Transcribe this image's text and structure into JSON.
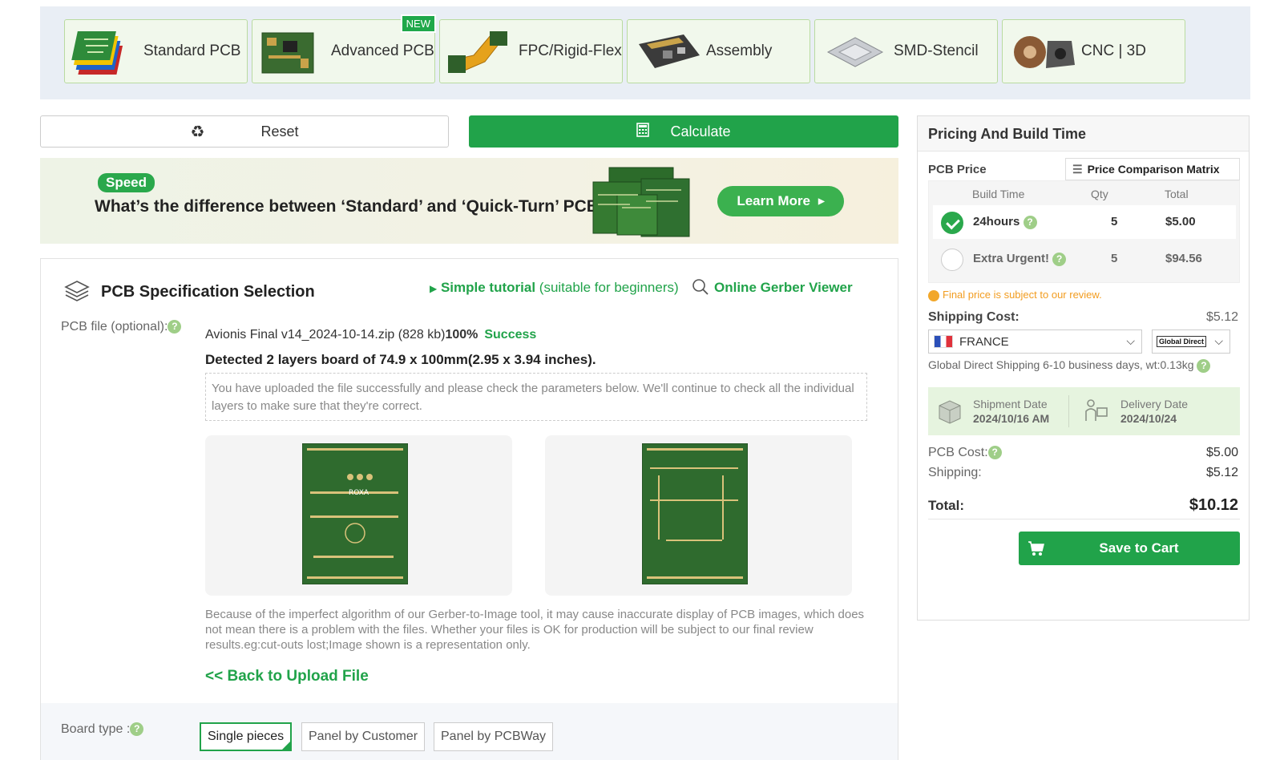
{
  "nav": {
    "products": [
      {
        "label": "Standard PCB",
        "icon": "standard-pcb-thumbnail"
      },
      {
        "label": "Advanced PCB",
        "icon": "advanced-pcb-thumbnail",
        "badge": "NEW"
      },
      {
        "label": "FPC/Rigid-Flex",
        "icon": "fpc-thumbnail"
      },
      {
        "label": "Assembly",
        "icon": "assembly-thumbnail"
      },
      {
        "label": "SMD-Stencil",
        "icon": "stencil-thumbnail"
      },
      {
        "label": "CNC | 3D",
        "icon": "cnc-thumbnail"
      }
    ]
  },
  "actions": {
    "reset_label": "Reset",
    "calculate_label": "Calculate"
  },
  "banner": {
    "badge": "Speed",
    "headline": "What’s the difference between ‘Standard’ and ‘Quick-Turn’ PCB",
    "cta": "Learn More"
  },
  "spec": {
    "title": "PCB Specification Selection",
    "tutorial_strong": "Simple tutorial",
    "tutorial_note": "(suitable for beginners)",
    "gerber_viewer": "Online Gerber Viewer",
    "file_label": "PCB file (optional):",
    "file_name": "Avionis Final v14_2024-10-14.zip (828 kb)",
    "file_progress": "100%",
    "file_status": "Success",
    "detected": "Detected 2 layers board of 74.9 x 100mm(2.95 x 3.94 inches).",
    "notice": "You have uploaded the file successfully and please check the parameters below. We'll continue to check all the individual layers to make sure that they're correct.",
    "disclaimer": "Because of the imperfect algorithm of our Gerber-to-Image tool, it may cause inaccurate display of PCB images, which does not mean there is a problem with the files. Whether your files is OK for production will be subject to our final review results.eg:cut-outs lost;Image shown is a representation only.",
    "back_link": "<< Back to Upload File",
    "board_type_label": "Board type :",
    "board_options": [
      "Single pieces",
      "Panel by Customer",
      "Panel by PCBWay"
    ],
    "board_selected": "Single pieces",
    "pcb_silkscreen_text": "ROXA"
  },
  "pricing": {
    "title": "Pricing And Build Time",
    "pcb_price_label": "PCB Price",
    "comparison_button": "Price Comparison Matrix",
    "columns": [
      "Build Time",
      "Qty",
      "Total"
    ],
    "rows": [
      {
        "name": "24hours",
        "qty": "5",
        "total": "$5.00",
        "selected": true
      },
      {
        "name": "Extra Urgent!",
        "qty": "5",
        "total": "$94.56",
        "selected": false
      }
    ],
    "review_note": "Final price is subject to our review.",
    "shipping_cost_label": "Shipping Cost:",
    "shipping_cost": "$5.12",
    "country": "FRANCE",
    "carrier_logo": "Global Direct",
    "shipping_info": "Global Direct Shipping   6-10 business days, wt:0.13kg",
    "shipment_date_label": "Shipment Date",
    "shipment_date": "2024/10/16 AM",
    "delivery_date_label": "Delivery Date",
    "delivery_date": "2024/10/24",
    "pcb_cost_label": "PCB Cost:",
    "pcb_cost": "$5.00",
    "shipping_label": "Shipping:",
    "shipping": "$5.12",
    "total_label": "Total:",
    "total": "$10.12",
    "cart_label": "Save to Cart"
  },
  "colors": {
    "brand_green": "#21a34a",
    "warning_orange": "#f29c1f",
    "nav_bg": "#e9eef5"
  }
}
